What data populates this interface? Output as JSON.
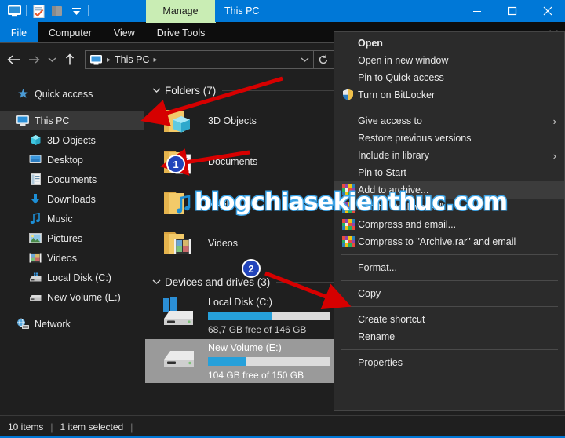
{
  "window": {
    "title": "This PC",
    "contextual_tab": "Manage",
    "quick_access_icons": [
      "this-pc-icon",
      "properties-icon",
      "new-folder-icon",
      "customize-dropdown-icon"
    ],
    "controls": {
      "minimize": "minimize-icon",
      "maximize": "maximize-icon",
      "close": "close-icon"
    }
  },
  "ribbon": {
    "tabs": [
      "File",
      "Computer",
      "View",
      "Drive Tools"
    ],
    "collapse_icon": "chevron-down-icon"
  },
  "address": {
    "nav": {
      "back": "back-arrow-icon",
      "forward": "forward-arrow-icon",
      "recent": "chevron-down-icon",
      "up": "up-arrow-icon"
    },
    "crumb_icon": "this-pc-icon",
    "crumb": "This PC",
    "dropdown_icon": "chevron-down-icon",
    "refresh_icon": "refresh-icon"
  },
  "sidebar": {
    "items": [
      {
        "label": "Quick access",
        "icon": "star-icon",
        "indent": false,
        "selected": false
      },
      {
        "label": "This PC",
        "icon": "this-pc-icon",
        "indent": false,
        "selected": true
      },
      {
        "label": "3D Objects",
        "icon": "3d-objects-icon",
        "indent": true,
        "selected": false
      },
      {
        "label": "Desktop",
        "icon": "desktop-icon",
        "indent": true,
        "selected": false
      },
      {
        "label": "Documents",
        "icon": "documents-icon",
        "indent": true,
        "selected": false
      },
      {
        "label": "Downloads",
        "icon": "downloads-icon",
        "indent": true,
        "selected": false
      },
      {
        "label": "Music",
        "icon": "music-icon",
        "indent": true,
        "selected": false
      },
      {
        "label": "Pictures",
        "icon": "pictures-icon",
        "indent": true,
        "selected": false
      },
      {
        "label": "Videos",
        "icon": "videos-icon",
        "indent": true,
        "selected": false
      },
      {
        "label": "Local Disk (C:)",
        "icon": "hard-drive-icon",
        "indent": true,
        "selected": false
      },
      {
        "label": "New Volume (E:)",
        "icon": "hard-drive-icon",
        "indent": true,
        "selected": false
      },
      {
        "label": "Network",
        "icon": "network-icon",
        "indent": false,
        "selected": false
      }
    ]
  },
  "content": {
    "folders_group": "Folders (7)",
    "folders": [
      {
        "name": "3D Objects",
        "icon": "folder-3d-objects-icon"
      },
      {
        "name": "Documents",
        "icon": "folder-documents-icon"
      },
      {
        "name": "Music",
        "icon": "folder-music-icon"
      },
      {
        "name": "Videos",
        "icon": "folder-videos-icon"
      }
    ],
    "drives_group": "Devices and drives (3)",
    "drives": [
      {
        "name": "Local Disk (C:)",
        "icon": "windows-drive-icon",
        "free_text": "68,7 GB free of 146 GB",
        "used_percent": 53,
        "selected": false
      },
      {
        "name": "New Volume (E:)",
        "icon": "hard-drive-icon",
        "free_text": "104 GB free of 150 GB",
        "used_percent": 31,
        "selected": true
      }
    ]
  },
  "context_menu": {
    "items": [
      {
        "label": "Open",
        "icon": null,
        "bold": true,
        "arrow": false,
        "highlighted": false,
        "separator_after": false
      },
      {
        "label": "Open in new window",
        "icon": null,
        "bold": false,
        "arrow": false,
        "highlighted": false,
        "separator_after": false
      },
      {
        "label": "Pin to Quick access",
        "icon": null,
        "bold": false,
        "arrow": false,
        "highlighted": false,
        "separator_after": false
      },
      {
        "label": "Turn on BitLocker",
        "icon": "bitlocker-shield-icon",
        "bold": false,
        "arrow": false,
        "highlighted": false,
        "separator_after": true
      },
      {
        "label": "Give access to",
        "icon": null,
        "bold": false,
        "arrow": true,
        "highlighted": false,
        "separator_after": false
      },
      {
        "label": "Restore previous versions",
        "icon": null,
        "bold": false,
        "arrow": false,
        "highlighted": false,
        "separator_after": false
      },
      {
        "label": "Include in library",
        "icon": null,
        "bold": false,
        "arrow": true,
        "highlighted": false,
        "separator_after": false
      },
      {
        "label": "Pin to Start",
        "icon": null,
        "bold": false,
        "arrow": false,
        "highlighted": false,
        "separator_after": false
      },
      {
        "label": "Add to archive...",
        "icon": "winrar-icon",
        "bold": false,
        "arrow": false,
        "highlighted": true,
        "separator_after": false
      },
      {
        "label": "Add to \"Archive.rar\"",
        "icon": "winrar-icon",
        "bold": false,
        "arrow": false,
        "highlighted": false,
        "separator_after": false
      },
      {
        "label": "Compress and email...",
        "icon": "winrar-icon",
        "bold": false,
        "arrow": false,
        "highlighted": false,
        "separator_after": false
      },
      {
        "label": "Compress to \"Archive.rar\" and email",
        "icon": "winrar-icon",
        "bold": false,
        "arrow": false,
        "highlighted": false,
        "separator_after": true
      },
      {
        "label": "Format...",
        "icon": null,
        "bold": false,
        "arrow": false,
        "highlighted": false,
        "separator_after": true
      },
      {
        "label": "Copy",
        "icon": null,
        "bold": false,
        "arrow": false,
        "highlighted": false,
        "separator_after": true
      },
      {
        "label": "Create shortcut",
        "icon": null,
        "bold": false,
        "arrow": false,
        "highlighted": false,
        "separator_after": false
      },
      {
        "label": "Rename",
        "icon": null,
        "bold": false,
        "arrow": false,
        "highlighted": false,
        "separator_after": true
      },
      {
        "label": "Properties",
        "icon": null,
        "bold": false,
        "arrow": false,
        "highlighted": false,
        "separator_after": false
      }
    ]
  },
  "statusbar": {
    "item_count": "10 items",
    "selection": "1 item selected"
  },
  "annotations": {
    "watermark": "blogchiasekienthuc.com",
    "markers": [
      {
        "label": "1"
      },
      {
        "label": "2"
      }
    ],
    "arrow_color": "#d60000"
  },
  "colors": {
    "accent": "#0078d7",
    "contextual_tab": "#c9edb4",
    "progress": "#26a0da",
    "marker": "#2244bb",
    "watermark_outline": "#3da5e8"
  }
}
